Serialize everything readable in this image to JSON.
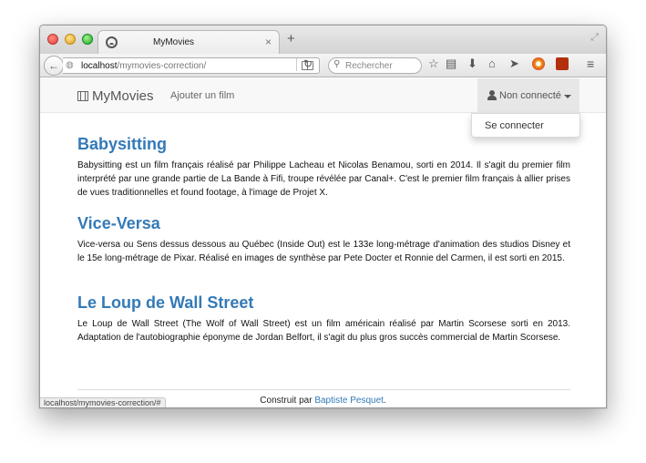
{
  "browser": {
    "tab_title": "MyMovies",
    "tab_close": "×",
    "new_tab": "+",
    "url_host": "localhost",
    "url_path": "/mymovies-correction/",
    "search_placeholder": "Rechercher",
    "status_url": "localhost/mymovies-correction/#"
  },
  "navbar": {
    "brand": "MyMovies",
    "add_link": "Ajouter un film",
    "user_label": "Non connecté"
  },
  "dropdown": {
    "items": [
      {
        "label": "Se connecter"
      }
    ]
  },
  "movies": [
    {
      "title": "Babysitting",
      "description": "Babysitting est un film français réalisé par Philippe Lacheau et Nicolas Benamou, sorti en 2014. Il s'agit du premier film interprété par une grande partie de La Bande à Fifi, troupe révélée par Canal+. C'est le premier film français à allier prises de vues traditionnelles et found footage, à l'image de Projet X."
    },
    {
      "title": "Vice-Versa",
      "description": "Vice-versa ou Sens dessus dessous au Québec (Inside Out) est le 133e long-métrage d'animation des studios Disney et le 15e long-métrage de Pixar. Réalisé en images de synthèse par Pete Docter et Ronnie del Carmen, il est sorti en 2015."
    },
    {
      "title": "Le Loup de Wall Street",
      "description": "Le Loup de Wall Street (The Wolf of Wall Street) est un film américain réalisé par Martin Scorsese sorti en 2013. Adaptation de l'autobiographie éponyme de Jordan Belfort, il s'agit du plus gros succès commercial de Martin Scorsese."
    }
  ],
  "footer": {
    "prefix": "Construit par ",
    "author": "Baptiste Pesquet",
    "suffix": "."
  },
  "colors": {
    "link": "#337ab7",
    "navbar_bg": "#f8f8f8",
    "active_nav_bg": "#e7e7e7"
  }
}
